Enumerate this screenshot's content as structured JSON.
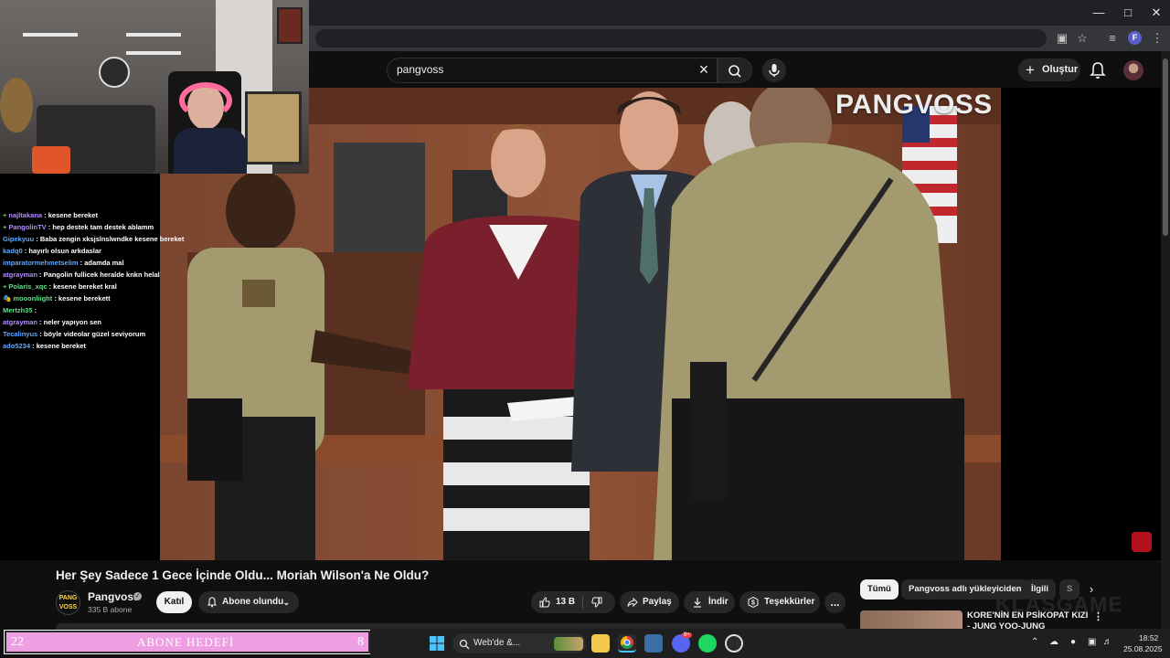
{
  "search": {
    "query": "pangvoss"
  },
  "header": {
    "create_label": "Oluştur"
  },
  "player": {
    "watermark": "PANGVOSS"
  },
  "video": {
    "title": "Her Şey Sadece 1 Gece İçinde Oldu... Moriah Wilson'a Ne Oldu?",
    "channel_name": "Pangvoss",
    "channel_avatar_text": "PANG VOSS",
    "subscriber_count": "335 B abone",
    "join_label": "Katıl",
    "subscribed_label": "Abone olundu",
    "like_count": "13 B",
    "share_label": "Paylaş",
    "download_label": "İndir",
    "thanks_label": "Teşekkürler",
    "more_label": "..."
  },
  "related": {
    "chips": [
      "Tümü",
      "Pangvoss adlı yükleyiciden",
      "İlgili",
      "S"
    ],
    "first_item_title": "KORE'NİN EN PSİKOPAT KIZI - JUNG YOO-JUNG",
    "faded_logo": "KLASGAME"
  },
  "chat": [
    {
      "user": "najltakana",
      "message": "kesene bereket",
      "color": "#b48cff",
      "badge": "+"
    },
    {
      "user": "PangolinTV",
      "message": "hep destek tam destek ablamm",
      "color": "#b48cff",
      "badge": "+"
    },
    {
      "user": "Gipekyuu",
      "message": "Baba zengin xksjslnslwndke kesene bereket",
      "color": "#5fa8ff",
      "badge": ""
    },
    {
      "user": "kadq0",
      "message": "hayırlı olsun arkdaslar",
      "color": "#5fa8ff",
      "badge": ""
    },
    {
      "user": "imparatormehmetselim",
      "message": "adamda mal",
      "color": "#5fa8ff",
      "badge": ""
    },
    {
      "user": "atgrayman",
      "message": "Pangolin fullicek heralde knkn helal",
      "color": "#b48cff",
      "badge": ""
    },
    {
      "user": "Polaris_xqc",
      "message": "kesene bereket kral",
      "color": "#5fe08a",
      "badge": "+"
    },
    {
      "user": "mooonliight",
      "message": "kesene berekett",
      "color": "#5fe08a",
      "badge": "🎭"
    },
    {
      "user": "Mertzh35",
      "message": "",
      "color": "#5fe08a",
      "badge": ""
    },
    {
      "user": "atgrayman",
      "message": "neler yapıyon sen",
      "color": "#b48cff",
      "badge": ""
    },
    {
      "user": "Tecalinyus",
      "message": "böyle videolar güzel seviyorum",
      "color": "#5fa8ff",
      "badge": ""
    },
    {
      "user": "ado5234",
      "message": "kesene bereket",
      "color": "#5fa8ff",
      "badge": ""
    }
  ],
  "goal": {
    "current": "22",
    "label": "ABONE HEDEFİ",
    "target": "8"
  },
  "taskbar": {
    "search_placeholder": "Web'de &...",
    "time": "18:52",
    "date": "25.08.2025",
    "discord_badge": "9+"
  },
  "profile_initial": "F"
}
